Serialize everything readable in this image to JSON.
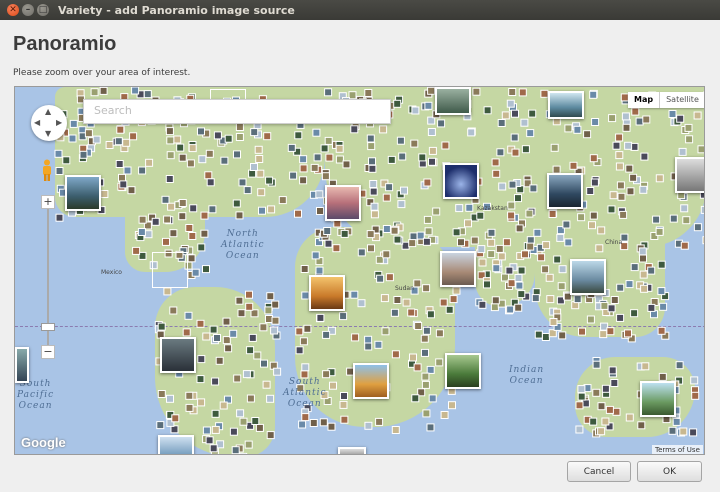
{
  "window": {
    "title": "Variety - add Panoramio image source",
    "close_glyph": "✕",
    "min_glyph": "–",
    "max_glyph": "□"
  },
  "dialog": {
    "heading": "Panoramio",
    "instruction": "Please zoom over your area of interest."
  },
  "map": {
    "search_placeholder": "Search",
    "map_type": {
      "map": "Map",
      "satellite": "Satellite",
      "selected": "Map"
    },
    "zoom": {
      "in": "+",
      "out": "−"
    },
    "oceans": {
      "north_atlantic": "North\nAtlantic\nOcean",
      "south_atlantic": "South\nAtlantic\nOcean",
      "indian": "Indian\nOcean",
      "south_pacific": "South\nPacific\nOcean"
    },
    "places": {
      "mexico": "Mexico",
      "kazakhstan": "Kazakstan",
      "china": "China",
      "sudan": "Sudan"
    },
    "google_logo": "Google",
    "terms": "Terms of Use",
    "colors": {
      "water": "#a9c4e6",
      "land": "#c5d7a3"
    }
  },
  "buttons": {
    "cancel": "Cancel",
    "ok": "OK"
  }
}
